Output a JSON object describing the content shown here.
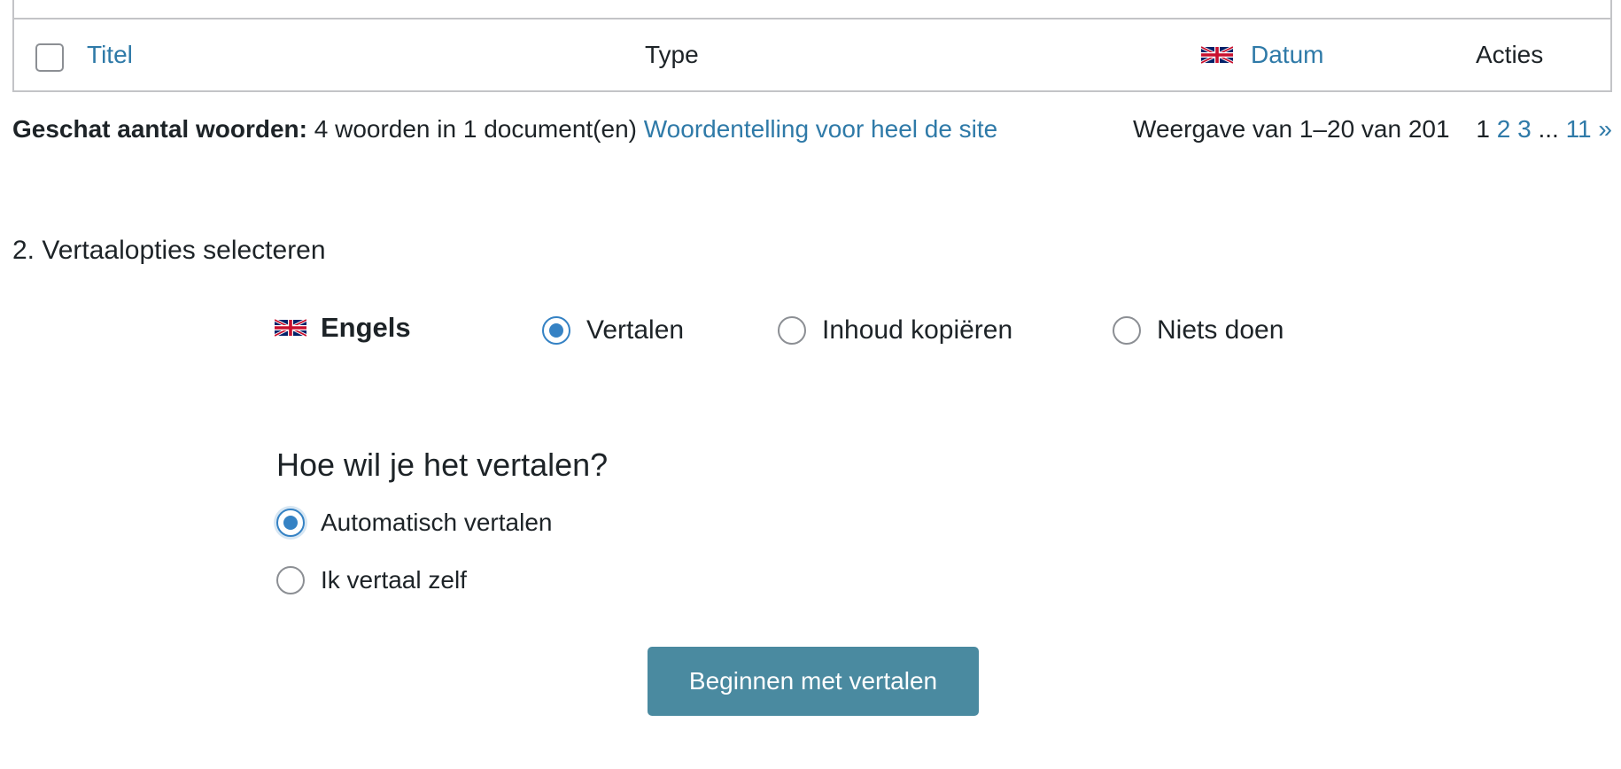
{
  "table": {
    "columns": {
      "title": "Titel",
      "type": "Type",
      "date": "Datum",
      "actions": "Acties"
    },
    "date_flag_icon": "uk-flag-icon"
  },
  "summary": {
    "label": "Geschat aantal woorden:",
    "value": "4 woorden in 1 document(en)",
    "link": "Woordentelling voor heel de site"
  },
  "pagination": {
    "display_text": "Weergave van 1–20 van 201",
    "current_page": "1",
    "pages": [
      "2",
      "3"
    ],
    "ellipsis": "...",
    "last_page": "11",
    "next": "»"
  },
  "section": {
    "title": "2. Vertaalopties selecteren"
  },
  "language": {
    "name": "Engels",
    "flag_icon": "uk-flag-icon",
    "options": {
      "translate": "Vertalen",
      "copy": "Inhoud kopiëren",
      "nothing": "Niets doen"
    },
    "selected": "translate"
  },
  "how": {
    "title": "Hoe wil je het vertalen?",
    "options": {
      "automatic": "Automatisch vertalen",
      "self": "Ik vertaal zelf"
    },
    "selected": "automatic"
  },
  "start_button": "Beginnen met vertalen",
  "colors": {
    "link": "#2f7aa8",
    "radio_accent": "#3582c4",
    "button_bg": "#4a8aa0",
    "border": "#c3c4c7"
  }
}
